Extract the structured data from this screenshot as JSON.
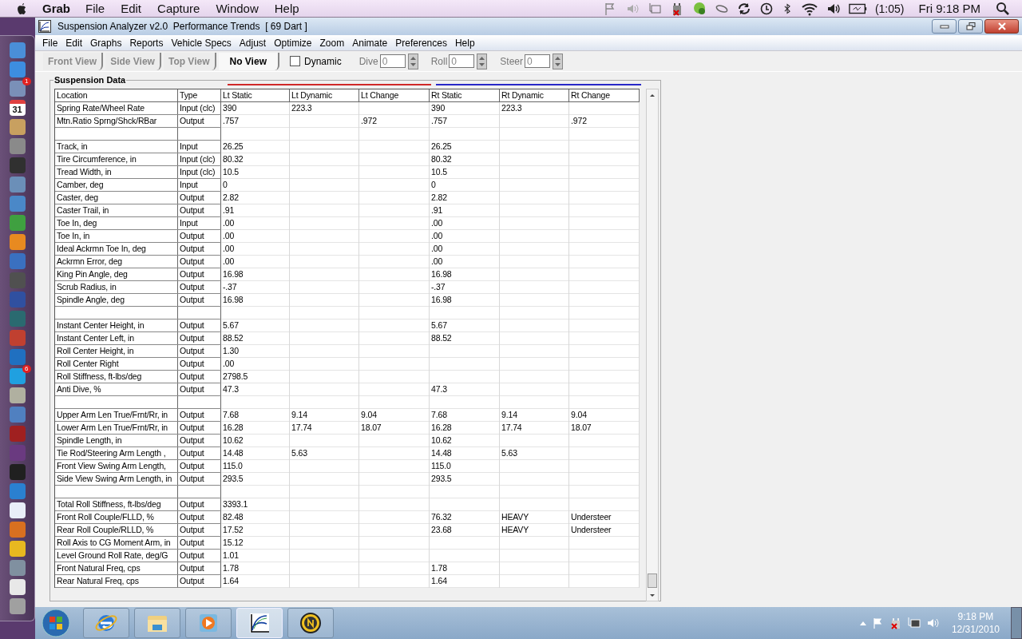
{
  "mac_menu_bar": {
    "app": "Grab",
    "menus": [
      "File",
      "Edit",
      "Capture",
      "Window",
      "Help"
    ],
    "battery_time": "(1:05)",
    "clock": "Fri 9:18 PM"
  },
  "dock": {
    "items": [
      {
        "kind": "app",
        "color": "#4a8fd8"
      },
      {
        "kind": "app",
        "color": "#3d8ee0"
      },
      {
        "kind": "app",
        "color": "#7a90b8",
        "badge": "1"
      },
      {
        "kind": "calendar",
        "color": "#e04040",
        "label": "31"
      },
      {
        "kind": "app",
        "color": "#c8a060"
      },
      {
        "kind": "app",
        "color": "#8a8a8a"
      },
      {
        "kind": "app",
        "color": "#303030"
      },
      {
        "kind": "app",
        "color": "#6b8fb8"
      },
      {
        "kind": "app",
        "color": "#4a88c8"
      },
      {
        "kind": "app",
        "color": "#3fa040"
      },
      {
        "kind": "app",
        "color": "#e88a20"
      },
      {
        "kind": "app",
        "color": "#3a70c0"
      },
      {
        "kind": "app",
        "color": "#505050"
      },
      {
        "kind": "app",
        "color": "#3050a0"
      },
      {
        "kind": "app",
        "color": "#2a6a70"
      },
      {
        "kind": "app",
        "color": "#c04030"
      },
      {
        "kind": "app",
        "color": "#2070c0"
      },
      {
        "kind": "app",
        "color": "#20a0e0",
        "badge": "6"
      },
      {
        "kind": "app",
        "color": "#b0b0a0"
      },
      {
        "kind": "app",
        "color": "#5080c0"
      },
      {
        "kind": "app",
        "color": "#a02020"
      },
      {
        "kind": "app",
        "color": "#6a3a80"
      },
      {
        "kind": "app",
        "color": "#202020"
      },
      {
        "kind": "app",
        "color": "#2a80d0"
      },
      {
        "kind": "app",
        "color": "#e8eef8"
      },
      {
        "kind": "app",
        "color": "#d87020"
      },
      {
        "kind": "app",
        "color": "#e8b820"
      },
      {
        "kind": "app",
        "color": "#8090a0"
      },
      {
        "kind": "app",
        "color": "#e8e8e8"
      },
      {
        "kind": "app",
        "color": "#a0a0a0"
      }
    ]
  },
  "window": {
    "title": "Suspension Analyzer v2.0  Performance Trends  [ 69 Dart ]"
  },
  "menu": [
    "File",
    "Edit",
    "Graphs",
    "Reports",
    "Vehicle Specs",
    "Adjust",
    "Optimize",
    "Zoom",
    "Animate",
    "Preferences",
    "Help"
  ],
  "view_tabs": [
    {
      "label": "Front View",
      "selected": false
    },
    {
      "label": "Side View",
      "selected": false
    },
    {
      "label": "Top View",
      "selected": false
    },
    {
      "label": "No View",
      "selected": true
    }
  ],
  "dynamic": {
    "label": "Dynamic",
    "checked": false
  },
  "spinners": [
    {
      "label": "Dive",
      "value": "0"
    },
    {
      "label": "Roll",
      "value": "0"
    },
    {
      "label": "Steer",
      "value": "0"
    }
  ],
  "group": {
    "title": "Suspension Data"
  },
  "column_groups": [
    {
      "color": "#d02828"
    },
    {
      "color": "#2828c8"
    }
  ],
  "table": {
    "columns": [
      "Location",
      "Type",
      "Lt Static",
      "Lt Dynamic",
      "Lt Change",
      "Rt Static",
      "Rt Dynamic",
      "Rt Change"
    ],
    "rows": [
      {
        "kind": "data",
        "cells": [
          "Spring Rate/Wheel Rate",
          "Input (clc)",
          "390",
          "223.3",
          null,
          "390",
          "223.3",
          null
        ]
      },
      {
        "kind": "data",
        "cells": [
          "Mtn.Ratio Sprng/Shck/RBar",
          "Output",
          ".757",
          null,
          ".972",
          ".757",
          null,
          ".972"
        ]
      },
      {
        "kind": "spacer"
      },
      {
        "kind": "data",
        "cells": [
          "Track, in",
          "Input",
          "26.25",
          null,
          null,
          "26.25",
          null,
          null
        ]
      },
      {
        "kind": "data",
        "cells": [
          "Tire Circumference, in",
          "Input (clc)",
          "80.32",
          null,
          null,
          "80.32",
          null,
          null
        ]
      },
      {
        "kind": "data",
        "cells": [
          "Tread Width, in",
          "Input (clc)",
          "10.5",
          null,
          null,
          "10.5",
          null,
          null
        ]
      },
      {
        "kind": "data",
        "cells": [
          "Camber, deg",
          "Input",
          "0",
          null,
          null,
          "0",
          null,
          null
        ]
      },
      {
        "kind": "data",
        "cells": [
          "Caster, deg",
          "Output",
          "2.82",
          null,
          null,
          "2.82",
          null,
          null
        ]
      },
      {
        "kind": "data",
        "cells": [
          "Caster Trail, in",
          "Output",
          ".91",
          null,
          null,
          ".91",
          null,
          null
        ]
      },
      {
        "kind": "data",
        "cells": [
          "Toe In, deg",
          "Input",
          ".00",
          null,
          null,
          ".00",
          null,
          null
        ]
      },
      {
        "kind": "data",
        "cells": [
          "Toe In, in",
          "Output",
          ".00",
          null,
          null,
          ".00",
          null,
          null
        ]
      },
      {
        "kind": "data",
        "cells": [
          "Ideal Ackrmn Toe In, deg",
          "Output",
          ".00",
          null,
          null,
          ".00",
          null,
          null
        ]
      },
      {
        "kind": "data",
        "cells": [
          "Ackrmn Error, deg",
          "Output",
          ".00",
          null,
          null,
          ".00",
          null,
          null
        ]
      },
      {
        "kind": "data",
        "cells": [
          "King Pin Angle, deg",
          "Output",
          "16.98",
          null,
          null,
          "16.98",
          null,
          null
        ]
      },
      {
        "kind": "data",
        "cells": [
          "Scrub Radius, in",
          "Output",
          "-.37",
          null,
          null,
          "-.37",
          null,
          null
        ]
      },
      {
        "kind": "data",
        "cells": [
          "Spindle Angle, deg",
          "Output",
          "16.98",
          null,
          null,
          "16.98",
          null,
          null
        ]
      },
      {
        "kind": "spacer"
      },
      {
        "kind": "data",
        "cells": [
          "Instant Center Height, in",
          "Output",
          "5.67",
          null,
          null,
          "5.67",
          null,
          null
        ]
      },
      {
        "kind": "data",
        "cells": [
          "Instant Center Left, in",
          "Output",
          "88.52",
          null,
          null,
          "88.52",
          null,
          null
        ]
      },
      {
        "kind": "data",
        "cells": [
          "Roll Center Height, in",
          "Output",
          "1.30",
          null,
          null,
          null,
          null,
          null
        ]
      },
      {
        "kind": "data",
        "cells": [
          "Roll Center Right",
          "Output",
          ".00",
          null,
          null,
          null,
          null,
          null
        ]
      },
      {
        "kind": "data",
        "cells": [
          "Roll Stiffness, ft-lbs/deg",
          "Output",
          "2798.5",
          null,
          null,
          null,
          null,
          null
        ]
      },
      {
        "kind": "data",
        "cells": [
          "Anti Dive, %",
          "Output",
          "47.3",
          null,
          null,
          "47.3",
          null,
          null
        ]
      },
      {
        "kind": "spacer"
      },
      {
        "kind": "data",
        "cells": [
          "Upper Arm Len True/Frnt/Rr, in",
          "Output",
          "7.68",
          "9.14",
          "9.04",
          "7.68",
          "9.14",
          "9.04"
        ]
      },
      {
        "kind": "data",
        "cells": [
          "Lower Arm Len True/Frnt/Rr, in",
          "Output",
          "16.28",
          "17.74",
          "18.07",
          "16.28",
          "17.74",
          "18.07"
        ]
      },
      {
        "kind": "data",
        "cells": [
          "Spindle Length, in",
          "Output",
          "10.62",
          null,
          null,
          "10.62",
          null,
          null
        ]
      },
      {
        "kind": "data",
        "cells": [
          "Tie Rod/Steering Arm Length ,",
          "Output",
          "14.48",
          "5.63",
          null,
          "14.48",
          "5.63",
          null
        ]
      },
      {
        "kind": "data",
        "cells": [
          "Front View Swing Arm Length,",
          "Output",
          "115.0",
          null,
          null,
          "115.0",
          null,
          null
        ]
      },
      {
        "kind": "data",
        "cells": [
          "Side View Swing Arm Length, in",
          "Output",
          "293.5",
          null,
          null,
          "293.5",
          null,
          null
        ]
      },
      {
        "kind": "spacer"
      },
      {
        "kind": "data",
        "cells": [
          "Total Roll Stiffness, ft-lbs/deg",
          "Output",
          "3393.1",
          null,
          null,
          null,
          null,
          null
        ]
      },
      {
        "kind": "data",
        "cells": [
          "Front Roll Couple/FLLD, %",
          "Output",
          "82.48",
          null,
          null,
          "76.32",
          "HEAVY",
          "Understeer"
        ]
      },
      {
        "kind": "data",
        "cells": [
          "Rear Roll Couple/RLLD, %",
          "Output",
          "17.52",
          null,
          null,
          "23.68",
          "HEAVY",
          "Understeer"
        ]
      },
      {
        "kind": "data",
        "cells": [
          "Roll Axis to CG Moment Arm, in",
          "Output",
          "15.12",
          null,
          null,
          null,
          null,
          null
        ]
      },
      {
        "kind": "data",
        "cells": [
          "Level Ground Roll Rate, deg/G",
          "Output",
          "1.01",
          null,
          null,
          null,
          null,
          null
        ]
      },
      {
        "kind": "data",
        "cells": [
          "Front Natural Freq, cps",
          "Output",
          "1.78",
          null,
          null,
          "1.78",
          null,
          null
        ]
      },
      {
        "kind": "data",
        "cells": [
          "Rear Natural Freq, cps",
          "Output",
          "1.64",
          null,
          null,
          "1.64",
          null,
          null
        ]
      }
    ]
  },
  "taskbar": {
    "items": [
      {
        "kind": "browser",
        "selected": false
      },
      {
        "kind": "folder",
        "selected": false
      },
      {
        "kind": "media",
        "selected": false
      },
      {
        "kind": "analyzer",
        "selected": true
      },
      {
        "kind": "norton",
        "selected": false
      }
    ],
    "time": "9:18 PM",
    "date": "12/31/2010"
  }
}
